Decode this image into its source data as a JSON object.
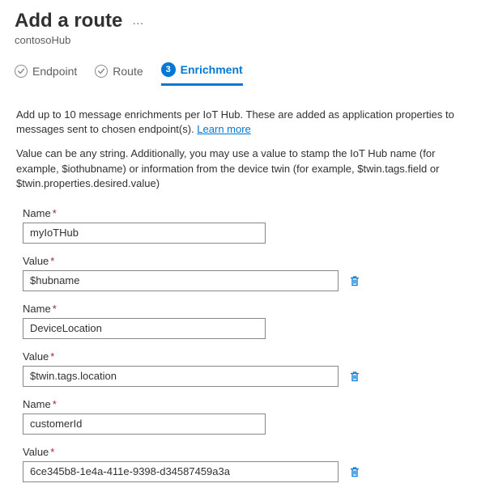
{
  "header": {
    "title": "Add a route",
    "subtitle": "contosoHub"
  },
  "tabs": {
    "endpoint": "Endpoint",
    "route": "Route",
    "enrichment_num": "3",
    "enrichment": "Enrichment"
  },
  "body": {
    "desc1_a": "Add up to 10 message enrichments per IoT Hub. These are added as application properties to messages sent to chosen endpoint(s). ",
    "desc1_link": "Learn more",
    "desc2": "Value can be any string. Additionally, you may use a value to stamp the IoT Hub name (for example, $iothubname) or information from the device twin (for example, $twin.tags.field or $twin.properties.desired.value)"
  },
  "labels": {
    "name": "Name",
    "value": "Value",
    "req": "*"
  },
  "entries": [
    {
      "name": "myIoTHub",
      "value": "$hubname"
    },
    {
      "name": "DeviceLocation",
      "value": "$twin.tags.location"
    },
    {
      "name": "customerId",
      "value": "6ce345b8-1e4a-411e-9398-d34587459a3a"
    }
  ]
}
